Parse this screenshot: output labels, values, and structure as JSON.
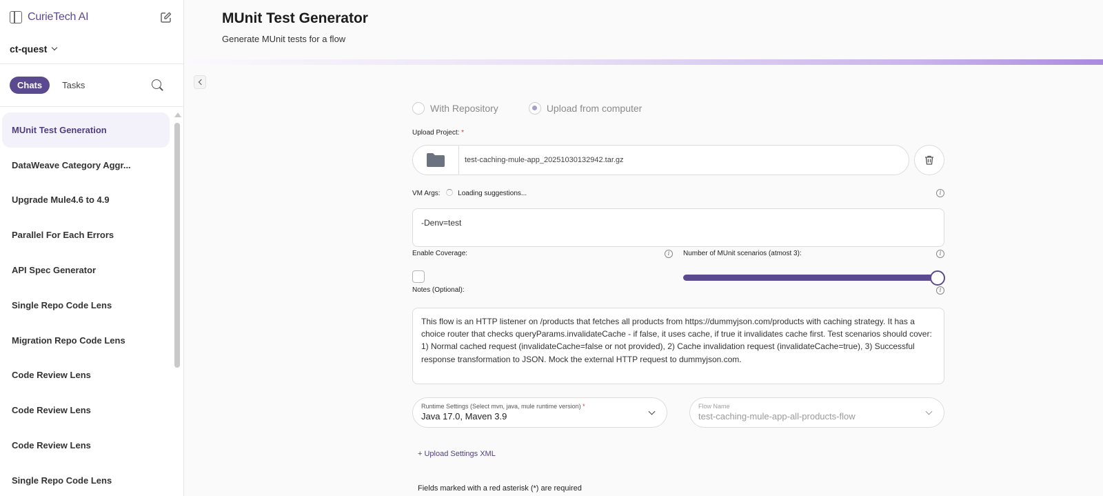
{
  "sidebar": {
    "brand": "CurieTech AI",
    "workspace": "ct-quest",
    "tabs": {
      "chats": "Chats",
      "tasks": "Tasks"
    },
    "items": [
      {
        "label": "MUnit Test Generation"
      },
      {
        "label": "DataWeave Category Aggr..."
      },
      {
        "label": "Upgrade Mule4.6 to 4.9"
      },
      {
        "label": "Parallel For Each Errors"
      },
      {
        "label": "API Spec Generator"
      },
      {
        "label": "Single Repo Code Lens"
      },
      {
        "label": "Migration Repo Code Lens"
      },
      {
        "label": "Code Review Lens"
      },
      {
        "label": "Code Review Lens"
      },
      {
        "label": "Code Review Lens"
      },
      {
        "label": "Single Repo Code Lens"
      }
    ]
  },
  "header": {
    "title": "MUnit Test Generator",
    "subtitle": "Generate MUnit tests for a flow"
  },
  "form": {
    "source_options": {
      "repo": "With Repository",
      "upload": "Upload from computer",
      "selected": "upload"
    },
    "upload_label": "Upload Project:",
    "required_mark": "*",
    "filename": "test-caching-mule-app_20251030132942.tar.gz",
    "vm_args_label": "VM Args:",
    "vm_args_loading": "Loading suggestions...",
    "vm_args_value": "-Denv=test",
    "coverage_label": "Enable Coverage:",
    "coverage_checked": false,
    "scenarios_label": "Number of MUnit scenarios (atmost 3):",
    "scenarios_value": 3,
    "notes_label": "Notes (Optional):",
    "notes_value": "This flow is an HTTP listener on /products that fetches all products from https://dummyjson.com/products with caching strategy. It has a choice router that checks queryParams.invalidateCache - if false, it uses cache, if true it invalidates cache first. Test scenarios should cover: 1) Normal cached request (invalidateCache=false or not provided), 2) Cache invalidation request (invalidateCache=true), 3) Successful response transformation to JSON. Mock the external HTTP request to dummyjson.com.",
    "runtime_label": "Runtime Settings (Select mvn, java, mule runtime version)",
    "runtime_value": "Java 17.0, Maven 3.9",
    "flow_label": "Flow Name",
    "flow_value": "test-caching-mule-app-all-products-flow",
    "upload_xml": "+ Upload Settings XML",
    "footnote": "Fields marked with a red asterisk (*) are required"
  },
  "colors": {
    "accent": "#5b4a8f",
    "required": "#d13a3a"
  }
}
